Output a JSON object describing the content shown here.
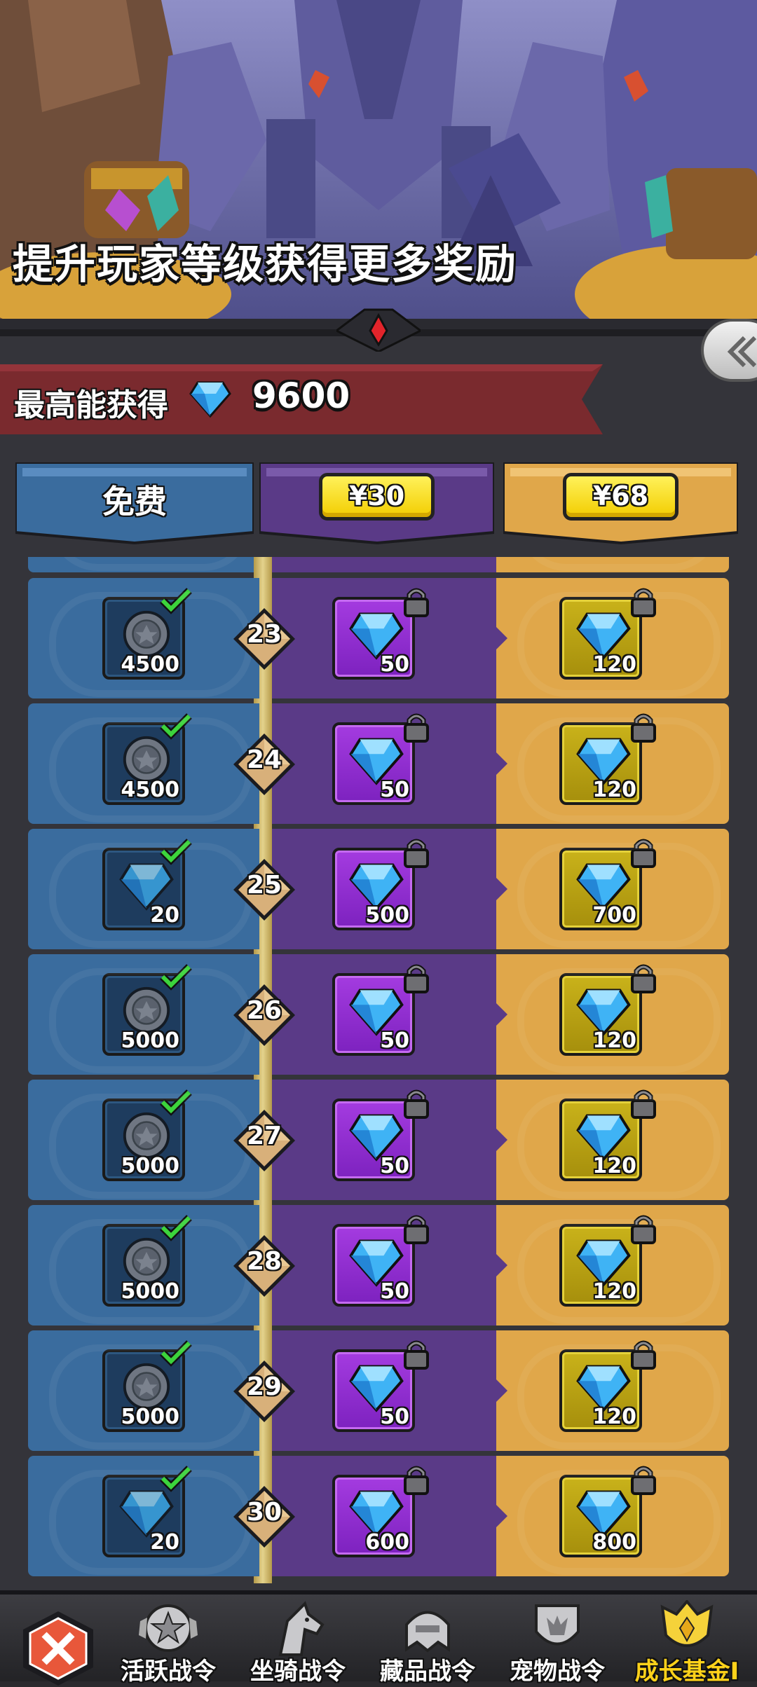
{
  "banner": {
    "title": "提升玩家等级获得更多奖励"
  },
  "max_reward": {
    "label": "最高能获得",
    "icon": "diamond-icon",
    "value": "9600"
  },
  "tiers": [
    {
      "id": "free",
      "label": "免费",
      "color": "#3a6c9e"
    },
    {
      "id": "t30",
      "price": "¥30",
      "color": "#5a3a87"
    },
    {
      "id": "t68",
      "price": "¥68",
      "color": "#e0a74a"
    }
  ],
  "rows": [
    {
      "level": "23",
      "free": {
        "icon": "coin-icon",
        "amount": "4500",
        "claimed": true
      },
      "t30": {
        "icon": "diamond-icon",
        "amount": "50",
        "locked": true
      },
      "t68": {
        "icon": "diamond-icon",
        "amount": "120",
        "locked": true
      }
    },
    {
      "level": "24",
      "free": {
        "icon": "coin-icon",
        "amount": "4500",
        "claimed": true
      },
      "t30": {
        "icon": "diamond-icon",
        "amount": "50",
        "locked": true
      },
      "t68": {
        "icon": "diamond-icon",
        "amount": "120",
        "locked": true
      }
    },
    {
      "level": "25",
      "free": {
        "icon": "diamond-icon",
        "amount": "20",
        "claimed": true
      },
      "t30": {
        "icon": "diamond-icon",
        "amount": "500",
        "locked": true
      },
      "t68": {
        "icon": "diamond-icon",
        "amount": "700",
        "locked": true
      }
    },
    {
      "level": "26",
      "free": {
        "icon": "coin-icon",
        "amount": "5000",
        "claimed": true
      },
      "t30": {
        "icon": "diamond-icon",
        "amount": "50",
        "locked": true
      },
      "t68": {
        "icon": "diamond-icon",
        "amount": "120",
        "locked": true
      }
    },
    {
      "level": "27",
      "free": {
        "icon": "coin-icon",
        "amount": "5000",
        "claimed": true
      },
      "t30": {
        "icon": "diamond-icon",
        "amount": "50",
        "locked": true
      },
      "t68": {
        "icon": "diamond-icon",
        "amount": "120",
        "locked": true
      }
    },
    {
      "level": "28",
      "free": {
        "icon": "coin-icon",
        "amount": "5000",
        "claimed": true
      },
      "t30": {
        "icon": "diamond-icon",
        "amount": "50",
        "locked": true
      },
      "t68": {
        "icon": "diamond-icon",
        "amount": "120",
        "locked": true
      }
    },
    {
      "level": "29",
      "free": {
        "icon": "coin-icon",
        "amount": "5000",
        "claimed": true
      },
      "t30": {
        "icon": "diamond-icon",
        "amount": "50",
        "locked": true
      },
      "t68": {
        "icon": "diamond-icon",
        "amount": "120",
        "locked": true
      }
    },
    {
      "level": "30",
      "free": {
        "icon": "diamond-icon",
        "amount": "20",
        "claimed": true
      },
      "t30": {
        "icon": "diamond-icon",
        "amount": "600",
        "locked": true
      },
      "t68": {
        "icon": "diamond-icon",
        "amount": "800",
        "locked": true
      }
    }
  ],
  "nav": {
    "close_icon": "crossed-swords-close-icon",
    "items": [
      {
        "label": "活跃战令",
        "icon": "star-badge-icon",
        "active": false
      },
      {
        "label": "坐骑战令",
        "icon": "horse-icon",
        "active": false
      },
      {
        "label": "藏品战令",
        "icon": "helmet-icon",
        "active": false
      },
      {
        "label": "宠物战令",
        "icon": "shield-pet-icon",
        "active": false
      },
      {
        "label": "成长基金I",
        "icon": "golden-crest-icon",
        "active": true
      }
    ]
  },
  "colors": {
    "accent_gold": "#ffd21a",
    "ribbon_red": "#7a2a2e",
    "price_yellow": "#f7dd1e"
  }
}
